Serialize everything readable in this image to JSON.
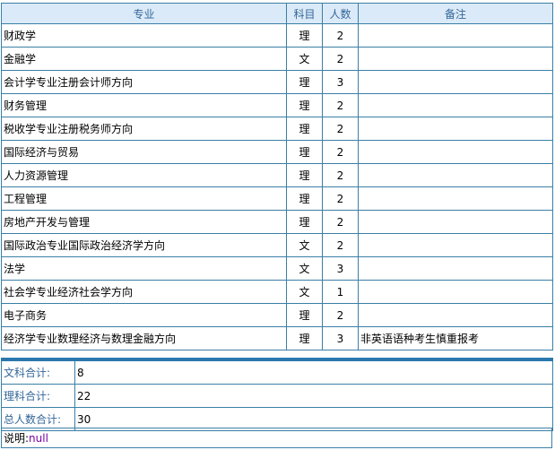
{
  "table": {
    "headers": [
      "专业",
      "科目",
      "人数",
      "备注"
    ],
    "rows": [
      {
        "major": "财政学",
        "subject": "理",
        "count": "2",
        "note": ""
      },
      {
        "major": "金融学",
        "subject": "文",
        "count": "2",
        "note": ""
      },
      {
        "major": "会计学专业注册会计师方向",
        "subject": "理",
        "count": "3",
        "note": ""
      },
      {
        "major": "财务管理",
        "subject": "理",
        "count": "2",
        "note": ""
      },
      {
        "major": "税收学专业注册税务师方向",
        "subject": "理",
        "count": "2",
        "note": ""
      },
      {
        "major": "国际经济与贸易",
        "subject": "理",
        "count": "2",
        "note": ""
      },
      {
        "major": "人力资源管理",
        "subject": "理",
        "count": "2",
        "note": ""
      },
      {
        "major": "工程管理",
        "subject": "理",
        "count": "2",
        "note": ""
      },
      {
        "major": "房地产开发与管理",
        "subject": "理",
        "count": "2",
        "note": ""
      },
      {
        "major": "国际政治专业国际政治经济学方向",
        "subject": "文",
        "count": "2",
        "note": ""
      },
      {
        "major": "法学",
        "subject": "文",
        "count": "3",
        "note": ""
      },
      {
        "major": "社会学专业经济社会学方向",
        "subject": "文",
        "count": "1",
        "note": ""
      },
      {
        "major": "电子商务",
        "subject": "理",
        "count": "2",
        "note": ""
      },
      {
        "major": "经济学专业数理经济与数理金融方向",
        "subject": "理",
        "count": "3",
        "note": "非英语语种考生慎重报考"
      }
    ]
  },
  "summary": [
    {
      "label": "文科合计:",
      "value": "8"
    },
    {
      "label": "理科合计:",
      "value": "22"
    },
    {
      "label": "总人数合计:",
      "value": "30"
    }
  ],
  "note": {
    "label": "说明:",
    "value": "null"
  }
}
